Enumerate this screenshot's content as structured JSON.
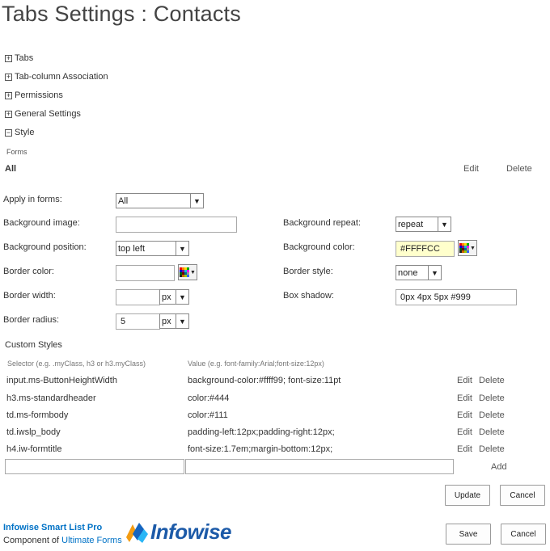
{
  "page": {
    "title": "Tabs Settings : Contacts"
  },
  "sections": [
    {
      "toggle": "+",
      "label": "Tabs"
    },
    {
      "toggle": "+",
      "label": "Tab-column Association"
    },
    {
      "toggle": "+",
      "label": "Permissions"
    },
    {
      "toggle": "+",
      "label": "General Settings"
    },
    {
      "toggle": "−",
      "label": "Style"
    }
  ],
  "style": {
    "forms_label": "Forms",
    "all_label": "All",
    "edit": "Edit",
    "delete": "Delete",
    "apply_in_forms": {
      "label": "Apply in forms:",
      "value": "All"
    },
    "background_image": {
      "label": "Background image:",
      "value": ""
    },
    "background_repeat": {
      "label": "Background repeat:",
      "value": "repeat"
    },
    "background_position": {
      "label": "Background position:",
      "value": "top left"
    },
    "background_color": {
      "label": "Background color:",
      "value": "#FFFFCC"
    },
    "border_color": {
      "label": "Border color:",
      "value": ""
    },
    "border_style": {
      "label": "Border style:",
      "value": "none"
    },
    "border_width": {
      "label": "Border width:",
      "value": "",
      "unit": "px"
    },
    "box_shadow": {
      "label": "Box shadow:",
      "value": "0px 4px 5px #999"
    },
    "border_radius": {
      "label": "Border radius:",
      "value": "5",
      "unit": "px"
    }
  },
  "custom_styles": {
    "title": "Custom Styles",
    "selector_header": "Selector (e.g. .myClass, h3 or h3.myClass)",
    "value_header": "Value (e.g. font-family:Arial;font-size:12px)",
    "rows": [
      {
        "selector": "input.ms-ButtonHeightWidth",
        "value": "background-color:#ffff99; font-size:11pt",
        "edit": "Edit",
        "delete": "Delete"
      },
      {
        "selector": "h3.ms-standardheader",
        "value": "color:#444",
        "edit": "Edit",
        "delete": "Delete"
      },
      {
        "selector": "td.ms-formbody",
        "value": "color:#111",
        "edit": "Edit",
        "delete": "Delete"
      },
      {
        "selector": "td.iwslp_body",
        "value": "padding-left:12px;padding-right:12px;",
        "edit": "Edit",
        "delete": "Delete"
      },
      {
        "selector": "h4.iw-formtitle",
        "value": "font-size:1.7em;margin-bottom:12px;",
        "edit": "Edit",
        "delete": "Delete"
      }
    ],
    "new_selector": "",
    "new_value": "",
    "add": "Add"
  },
  "buttons": {
    "update": "Update",
    "cancel": "Cancel",
    "save": "Save",
    "cancel2": "Cancel"
  },
  "footer": {
    "product": "Infowise Smart List Pro",
    "component_of": "Component of ",
    "component_link": "Ultimate Forms",
    "logo_text": "Infowise"
  },
  "colors": {
    "accent": "#0072c6",
    "background_color_value": "#FFFFCC"
  },
  "icons": {
    "expand": "plus-box-icon",
    "collapse": "minus-box-icon",
    "dropdown": "chevron-down-icon",
    "color_picker": "color-palette-icon"
  }
}
